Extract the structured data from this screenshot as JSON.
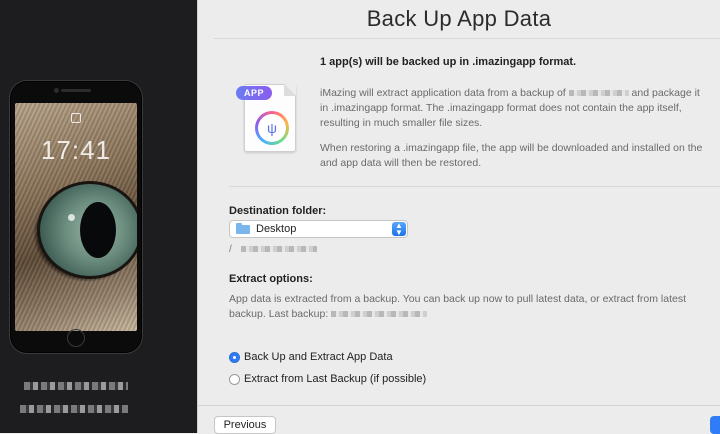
{
  "device": {
    "lock_time": "17:41",
    "name_text": "",
    "info_text": ""
  },
  "header": {
    "title": "Back Up App Data"
  },
  "info": {
    "app_badge": "APP",
    "heading": "1 app(s) will be backed up in .imazingapp format.",
    "para1_line1_start": "iMazing will extract application data from a backup of ",
    "para1_line1_end": " and package it",
    "para1_line2": "in .imazingapp format. The .imazingapp format does not contain the app itself,",
    "para1_line3": "resulting in much smaller file sizes.",
    "para2_line1": "When restoring a .imazingapp file, the app will be downloaded and installed on the",
    "para2_line2": "and app data will then be restored."
  },
  "destination": {
    "label": "Destination folder:",
    "selected": "Desktop",
    "path_prefix": "/"
  },
  "extract": {
    "label": "Extract options:",
    "description_line1": "App data is extracted from a backup. You can back up now to pull latest data, or extract from latest",
    "description_line2_prefix": "backup. Last backup:",
    "options": [
      {
        "label": "Back Up and Extract App Data",
        "selected": true
      },
      {
        "label": "Extract from Last Backup (if possible)",
        "selected": false
      }
    ]
  },
  "footer": {
    "previous_label": "Previous"
  }
}
